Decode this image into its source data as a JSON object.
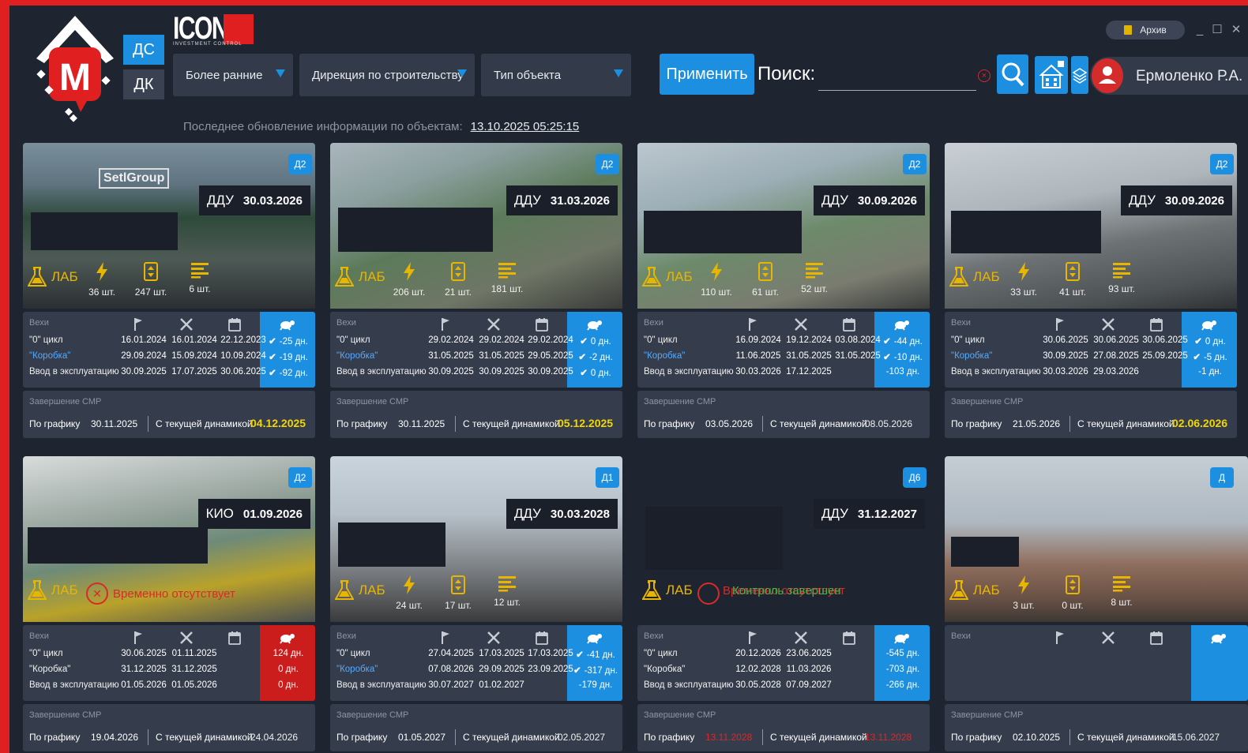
{
  "header": {
    "mode_ds": "ДС",
    "mode_dk": "ДК",
    "brand": "ICONA",
    "brand_sub": "INVESTMENT CONTROL",
    "filters": [
      "Более ранние",
      "Дирекция по строительству",
      "Тип объекта"
    ],
    "apply_label": "Применить",
    "search_label": "Поиск:",
    "search_value": "",
    "user_name": "Ермоленко Р.А.",
    "archive_label": "Архив",
    "last_update_label": "Последнее обновление информации по объектам:",
    "last_update_value": "13.10.2025 05:25:15"
  },
  "labels": {
    "lab": "ЛАБ",
    "milestones": "Вехи",
    "smr_title": "Завершение СМР",
    "by_schedule": "По графику",
    "current_dynamics": "С текущей динамикой",
    "absent": "Временно отсутствует",
    "control_a": "Временно отсутствует",
    "control_b": "Контроль завершен"
  },
  "colors": {
    "accent": "#1c8fe0",
    "alert": "#d62b2b",
    "highlight": "#f2d600",
    "ok": "#4cb04c"
  },
  "cards": [
    {
      "badge": "Д2",
      "deadline_label": "ДДУ",
      "deadline": "30.03.2026",
      "image_text": "SetlGroup",
      "stats": [
        "36 шт.",
        "247 шт.",
        "6 шт."
      ],
      "milestones": [
        {
          "name": "\"0\" цикл",
          "c1": "16.01.2024",
          "c2": "16.01.2024",
          "c3": "22.12.2023",
          "status": "-25 дн.",
          "blue": false
        },
        {
          "name": "\"Коробка\"",
          "c1": "29.09.2024",
          "c2": "15.09.2024",
          "c3": "10.09.2024",
          "status": "-19 дн.",
          "blue": true
        },
        {
          "name": "Ввод в эксплуатацию",
          "c1": "30.09.2025",
          "c2": "17.07.2025",
          "c3": "30.06.2025",
          "status": "-92 дн.",
          "blue": false
        }
      ],
      "smr_schedule": "30.11.2025",
      "smr_current": "04.12.2025"
    },
    {
      "badge": "Д2",
      "deadline_label": "ДДУ",
      "deadline": "31.03.2026",
      "stats": [
        "206 шт.",
        "21 шт.",
        "181 шт."
      ],
      "milestones": [
        {
          "name": "\"0\" цикл",
          "c1": "29.02.2024",
          "c2": "29.02.2024",
          "c3": "29.02.2024",
          "status": "0 дн.",
          "blue": false
        },
        {
          "name": "\"Коробка\"",
          "c1": "31.05.2025",
          "c2": "31.05.2025",
          "c3": "29.05.2025",
          "status": "-2 дн.",
          "blue": true
        },
        {
          "name": "Ввод в эксплуатацию",
          "c1": "30.09.2025",
          "c2": "30.09.2025",
          "c3": "30.09.2025",
          "status": "0 дн.",
          "blue": false
        }
      ],
      "smr_schedule": "30.11.2025",
      "smr_current": "05.12.2025"
    },
    {
      "badge": "Д2",
      "deadline_label": "ДДУ",
      "deadline": "30.09.2026",
      "stats": [
        "110 шт.",
        "61 шт.",
        "52 шт."
      ],
      "milestones": [
        {
          "name": "\"0\" цикл",
          "c1": "16.09.2024",
          "c2": "19.12.2024",
          "c3": "03.08.2024",
          "status": "-44 дн.",
          "blue": false
        },
        {
          "name": "\"Коробка\"",
          "c1": "11.06.2025",
          "c2": "31.05.2025",
          "c3": "31.05.2025",
          "status": "-10 дн.",
          "blue": true
        },
        {
          "name": "Ввод в эксплуатацию",
          "c1": "30.03.2026",
          "c2": "17.12.2025",
          "c3": "",
          "status": "-103 дн.",
          "blue": false
        }
      ],
      "smr_schedule": "03.05.2026",
      "smr_current": "08.05.2026"
    },
    {
      "badge": "Д2",
      "deadline_label": "ДДУ",
      "deadline": "30.09.2026",
      "stats": [
        "33 шт.",
        "41 шт.",
        "93 шт."
      ],
      "milestones": [
        {
          "name": "\"0\" цикл",
          "c1": "30.06.2025",
          "c2": "30.06.2025",
          "c3": "30.06.2025",
          "status": "0 дн.",
          "blue": false
        },
        {
          "name": "\"Коробка\"",
          "c1": "30.09.2025",
          "c2": "27.08.2025",
          "c3": "25.09.2025",
          "status": "-5 дн.",
          "blue": true
        },
        {
          "name": "Ввод в эксплуатацию",
          "c1": "30.03.2026",
          "c2": "29.03.2026",
          "c3": "",
          "status": "-1 дн.",
          "blue": false
        }
      ],
      "smr_schedule": "21.05.2026",
      "smr_current": "02.06.2026"
    },
    {
      "badge": "Д2",
      "deadline_label": "КИО",
      "deadline": "01.09.2026",
      "milestones": [
        {
          "name": "\"0\" цикл",
          "c1": "30.06.2025",
          "c2": "01.11.2025",
          "c3": "",
          "status": "124 дн.",
          "blue": false
        },
        {
          "name": "\"Коробка\"",
          "c1": "31.12.2025",
          "c2": "31.12.2025",
          "c3": "",
          "status": "0 дн.",
          "blue": false
        },
        {
          "name": "Ввод в эксплуатацию",
          "c1": "01.05.2026",
          "c2": "01.05.2026",
          "c3": "",
          "status": "0 дн.",
          "blue": false
        }
      ],
      "smr_schedule": "19.04.2026",
      "smr_current": "24.04.2026"
    },
    {
      "badge": "Д1",
      "deadline_label": "ДДУ",
      "deadline": "30.03.2028",
      "stats": [
        "24 шт.",
        "17 шт.",
        "12 шт."
      ],
      "milestones": [
        {
          "name": "\"0\" цикл",
          "c1": "27.04.2025",
          "c2": "17.03.2025",
          "c3": "17.03.2025",
          "status": "-41 дн.",
          "blue": false
        },
        {
          "name": "\"Коробка\"",
          "c1": "07.08.2026",
          "c2": "29.09.2025",
          "c3": "23.09.2025",
          "status": "-317 дн.",
          "blue": true
        },
        {
          "name": "Ввод в эксплуатацию",
          "c1": "30.07.2027",
          "c2": "01.02.2027",
          "c3": "",
          "status": "-179 дн.",
          "blue": false
        }
      ],
      "smr_schedule": "01.05.2027",
      "smr_current": "02.05.2027"
    },
    {
      "badge": "Д6",
      "deadline_label": "ДДУ",
      "deadline": "31.12.2027",
      "milestones": [
        {
          "name": "\"0\" цикл",
          "c1": "20.12.2026",
          "c2": "23.06.2025",
          "c3": "",
          "status": "-545 дн.",
          "blue": false
        },
        {
          "name": "\"Коробка\"",
          "c1": "12.02.2028",
          "c2": "11.03.2026",
          "c3": "",
          "status": "-703 дн.",
          "blue": false
        },
        {
          "name": "Ввод в эксплуатацию",
          "c1": "30.05.2028",
          "c2": "07.09.2027",
          "c3": "",
          "status": "-266 дн.",
          "blue": false
        }
      ],
      "smr_schedule": "13.11.2028",
      "smr_current": "13.11.2028"
    },
    {
      "badge": "Д",
      "stats": [
        "3 шт.",
        "0 шт.",
        "8 шт."
      ],
      "milestones": [],
      "smr_schedule": "02.10.2025",
      "smr_current": "15.06.2027"
    }
  ]
}
